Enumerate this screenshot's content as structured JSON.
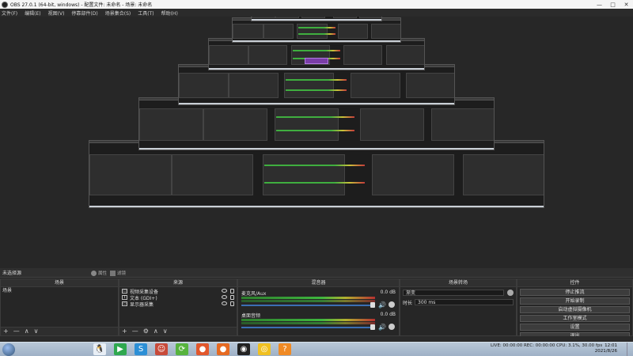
{
  "window": {
    "title": "OBS 27.0.1 (64-bit, windows) - 配置文件: 未命名 - 场景: 未命名",
    "controls": [
      "—",
      "□",
      "✕"
    ]
  },
  "menu": [
    "文件(F)",
    "编辑(E)",
    "视图(V)",
    "停靠部件(D)",
    "场景集合(S)",
    "工具(T)",
    "帮助(H)"
  ],
  "scene_bar": {
    "current_scene": "未选择源",
    "properties_label": "属性",
    "filters_label": "滤镜"
  },
  "scenes": {
    "header": "场景",
    "items": [
      "场景"
    ],
    "footer": [
      "+",
      "—",
      "∧",
      "∨"
    ]
  },
  "sources": {
    "header": "来源",
    "items": [
      {
        "icon": "camera-icon",
        "glyph": "▭",
        "label": "视频采集设备"
      },
      {
        "icon": "text-icon",
        "glyph": "T",
        "label": "文本 (GDI+)"
      },
      {
        "icon": "monitor-icon",
        "glyph": "▭",
        "label": "显示器采集"
      }
    ],
    "footer": [
      "+",
      "—",
      "⚙",
      "∧",
      "∨"
    ]
  },
  "mixer": {
    "header": "混音器",
    "channels": [
      {
        "name": "麦克风/Aux",
        "db": "0.0 dB"
      },
      {
        "name": "桌面音频",
        "db": "0.0 dB"
      }
    ]
  },
  "transitions": {
    "header": "场景转场",
    "transition": "渐变",
    "duration_label": "时长",
    "duration": "300 ms"
  },
  "controls": {
    "header": "控件",
    "buttons": [
      "停止推流",
      "开始录制",
      "启动虚拟摄像机",
      "工作室模式",
      "设置",
      "退出"
    ]
  },
  "taskbar": {
    "apps": [
      {
        "name": "qq-icon",
        "glyph": "🐧",
        "color": "#e8eef5"
      },
      {
        "name": "player-icon",
        "glyph": "▶",
        "color": "#2fa84f"
      },
      {
        "name": "s-app-icon",
        "glyph": "S",
        "color": "#2c8fd6"
      },
      {
        "name": "character-icon",
        "glyph": "☺",
        "color": "#c84a3a"
      },
      {
        "name": "refresh-icon",
        "glyph": "⟳",
        "color": "#57b33e"
      },
      {
        "name": "orange-app-icon",
        "glyph": "●",
        "color": "#e2572c"
      },
      {
        "name": "orange-app2-icon",
        "glyph": "●",
        "color": "#e66a22"
      },
      {
        "name": "obs-icon",
        "glyph": "◉",
        "color": "#222222"
      },
      {
        "name": "camera-app-icon",
        "glyph": "◎",
        "color": "#f0c020"
      },
      {
        "name": "question-app-icon",
        "glyph": "?",
        "color": "#f08a24"
      }
    ],
    "status": "LIVE: 00:00:00    REC: 00:00:00    CPU: 3.1%, 30.00 fps",
    "time": "12:01",
    "date": "2021/8/26"
  }
}
